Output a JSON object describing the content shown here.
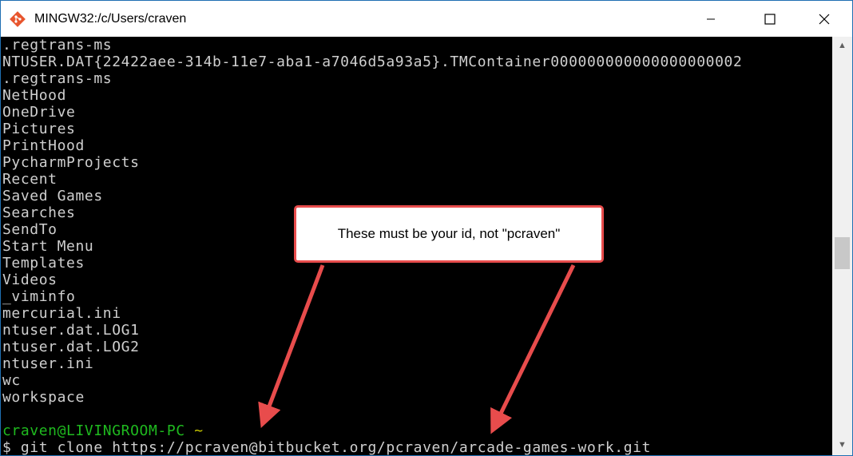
{
  "window": {
    "title": "MINGW32:/c/Users/craven",
    "minimize_icon": "minimize-icon",
    "maximize_icon": "maximize-icon",
    "close_icon": "close-icon"
  },
  "terminal": {
    "lines": [
      ".regtrans-ms",
      "NTUSER.DAT{22422aee-314b-11e7-aba1-a7046d5a93a5}.TMContainer000000000000000000002",
      ".regtrans-ms",
      "NetHood",
      "OneDrive",
      "Pictures",
      "PrintHood",
      "PycharmProjects",
      "Recent",
      "Saved Games",
      "Searches",
      "SendTo",
      "Start Menu",
      "Templates",
      "Videos",
      "_viminfo",
      "mercurial.ini",
      "ntuser.dat.LOG1",
      "ntuser.dat.LOG2",
      "ntuser.ini",
      "wc",
      "workspace"
    ],
    "prompt_user": "craven@LIVINGROOM-PC",
    "prompt_path": "~",
    "command": "$ git clone https://pcraven@bitbucket.org/pcraven/arcade-games-work.git"
  },
  "callout": {
    "text": "These must be your id, not \"pcraven\""
  },
  "colors": {
    "callout_border": "#e84c4c",
    "arrow": "#e84c4c",
    "prompt_user": "#1fba1f",
    "prompt_path": "#c8c800"
  }
}
